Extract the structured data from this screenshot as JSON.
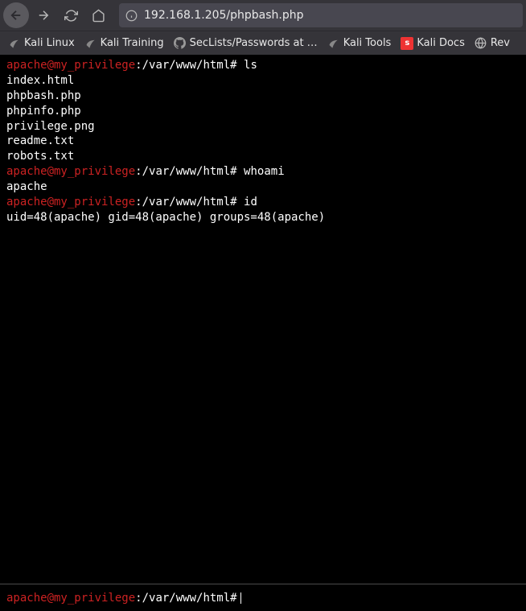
{
  "browser": {
    "url": "192.168.1.205/phpbash.php"
  },
  "bookmarks": {
    "kali_linux": "Kali Linux",
    "kali_training": "Kali Training",
    "seclists": "SecLists/Passwords at …",
    "kali_tools": "Kali Tools",
    "kali_docs": "Kali Docs",
    "kali_docs_icon": "s",
    "rev": "Rev"
  },
  "terminal": {
    "prompts": {
      "user_host": "apache@my_privilege",
      "separator": ":",
      "path": "/var/www/html",
      "hash": "#"
    },
    "commands": {
      "ls": "ls",
      "whoami": "whoami",
      "id": "id"
    },
    "output": {
      "ls": [
        "index.html",
        "phpbash.php",
        "phpinfo.php",
        "privilege.png",
        "readme.txt",
        "robots.txt"
      ],
      "whoami": "apache",
      "id": "uid=48(apache) gid=48(apache) groups=48(apache)"
    }
  }
}
